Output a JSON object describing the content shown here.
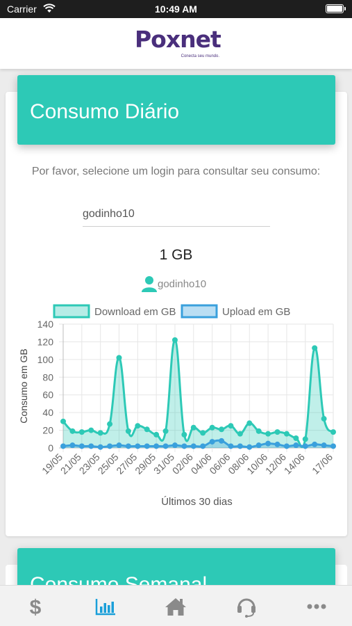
{
  "status_bar": {
    "carrier": "Carrier",
    "time": "10:49 AM"
  },
  "header": {
    "logo_text": "Poxnet",
    "logo_tagline": "Conecta seu mundo."
  },
  "daily_card": {
    "title": "Consumo Diário",
    "instruction": "Por favor, selecione um login para consultar seu consumo:",
    "login_value": "godinho10",
    "login_placeholder": "",
    "total": "1 GB",
    "user": "godinho10"
  },
  "chart_data": {
    "type": "area",
    "xlabel": "Últimos 30 dias",
    "ylabel": "Consumo em GB",
    "ylim": [
      0,
      140
    ],
    "yticks": [
      0,
      20,
      40,
      60,
      80,
      100,
      120,
      140
    ],
    "grid": true,
    "legend_position": "top",
    "categories": [
      "19/05",
      "20/05",
      "21/05",
      "22/05",
      "23/05",
      "24/05",
      "25/05",
      "26/05",
      "27/05",
      "28/05",
      "29/05",
      "30/05",
      "31/05",
      "01/06",
      "02/06",
      "03/06",
      "04/06",
      "05/06",
      "06/06",
      "07/06",
      "08/06",
      "09/06",
      "10/06",
      "11/06",
      "12/06",
      "13/06",
      "14/06",
      "15/06",
      "16/06",
      "17/06"
    ],
    "tick_labels": [
      "19/05",
      "21/05",
      "23/05",
      "25/05",
      "27/05",
      "29/05",
      "31/05",
      "02/06",
      "04/06",
      "06/06",
      "08/06",
      "10/06",
      "12/06",
      "14/06",
      "17/06"
    ],
    "series": [
      {
        "name": "Download em GB",
        "color": "#2dc9b6",
        "values": [
          30,
          19,
          18,
          20,
          17,
          27,
          102,
          19,
          25,
          21,
          15,
          19,
          122,
          15,
          23,
          17,
          23,
          21,
          25,
          16,
          28,
          19,
          16,
          18,
          16,
          11,
          10,
          113,
          33,
          18
        ]
      },
      {
        "name": "Upload em GB",
        "color": "#3aa0dc",
        "values": [
          2,
          3,
          2,
          2,
          1,
          2,
          3,
          2,
          2,
          2,
          2,
          2,
          3,
          2,
          2,
          2,
          7,
          8,
          2,
          2,
          1,
          3,
          5,
          4,
          2,
          3,
          2,
          4,
          3,
          2
        ]
      }
    ]
  },
  "weekly_card": {
    "title": "Consumo Semanal"
  },
  "tabs": [
    {
      "icon": "dollar-icon",
      "active": false
    },
    {
      "icon": "bar-chart-icon",
      "active": true
    },
    {
      "icon": "home-icon",
      "active": false
    },
    {
      "icon": "headset-icon",
      "active": false
    },
    {
      "icon": "more-icon",
      "active": false
    }
  ],
  "colors": {
    "accent": "#2dc9b6",
    "brand": "#4a2f7c",
    "tab_active": "#1a9fd9",
    "tab_inactive": "#8a8a8a"
  }
}
